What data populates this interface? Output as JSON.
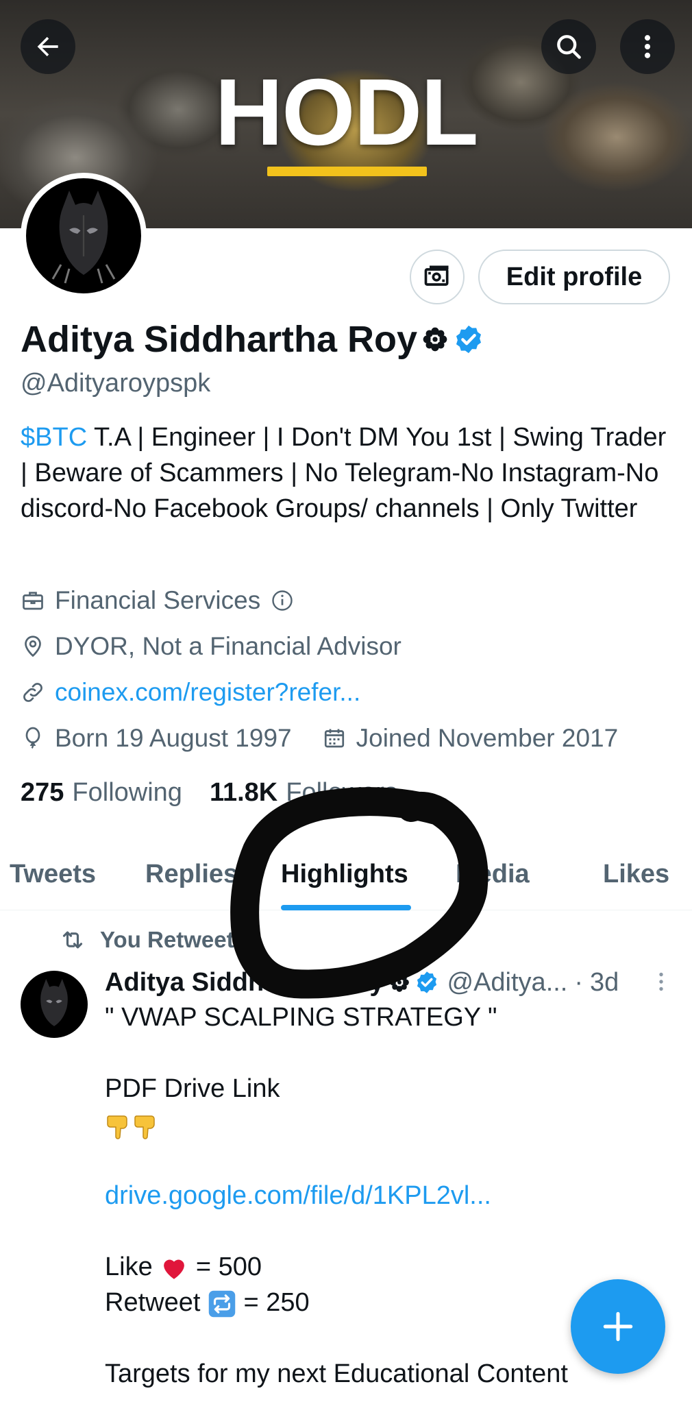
{
  "banner": {
    "text": "HODL",
    "accent_color": "#f2c21c"
  },
  "header_actions": {
    "back_icon": "arrow-left-icon",
    "search_icon": "search-icon",
    "more_icon": "more-vertical-icon"
  },
  "profile": {
    "edit_label": "Edit profile",
    "monetize_icon": "cash-icon",
    "name": "Aditya Siddhartha Roy",
    "name_badge_icon": "flower-icon",
    "verified_icon": "verified-badge-icon",
    "handle": "@Adityaroypspk",
    "bio_cashtag": "$BTC",
    "bio_text": " T.A | Engineer | I Don't DM You 1st | Swing Trader | Beware of Scammers | No Telegram-No Instagram-No discord-No Facebook Groups/ channels | Only Twitter",
    "category": "Financial Services",
    "location": "DYOR, Not a Financial Advisor",
    "website": "coinex.com/register?refer...",
    "birth": "Born 19 August 1997",
    "joined": "Joined November 2017",
    "following_count": "275",
    "following_label": "Following",
    "followers_count": "11.8K",
    "followers_label": "Followers"
  },
  "tabs": {
    "items": [
      "Tweets",
      "Replies",
      "Highlights",
      "Media",
      "Likes"
    ],
    "active": "Highlights"
  },
  "tweet": {
    "context": "You Retweeted",
    "author_name": "Aditya Siddhartha Roy",
    "author_handle": "@Aditya...",
    "dot": "·",
    "time": "3d",
    "line1": "\" VWAP SCALPING STRATEGY \"",
    "line2": "PDF Drive Link",
    "link": "drive.google.com/file/d/1KPL2vl...",
    "like_label": "Like",
    "like_value": " = 500",
    "retweet_label": "Retweet",
    "retweet_value": " = 250",
    "line_last": "Targets for my next Educational Content"
  },
  "fab": {
    "icon": "plus-icon"
  },
  "colors": {
    "brand_blue": "#1d9bf0",
    "text_primary": "#0f1419",
    "text_secondary": "#536471"
  }
}
